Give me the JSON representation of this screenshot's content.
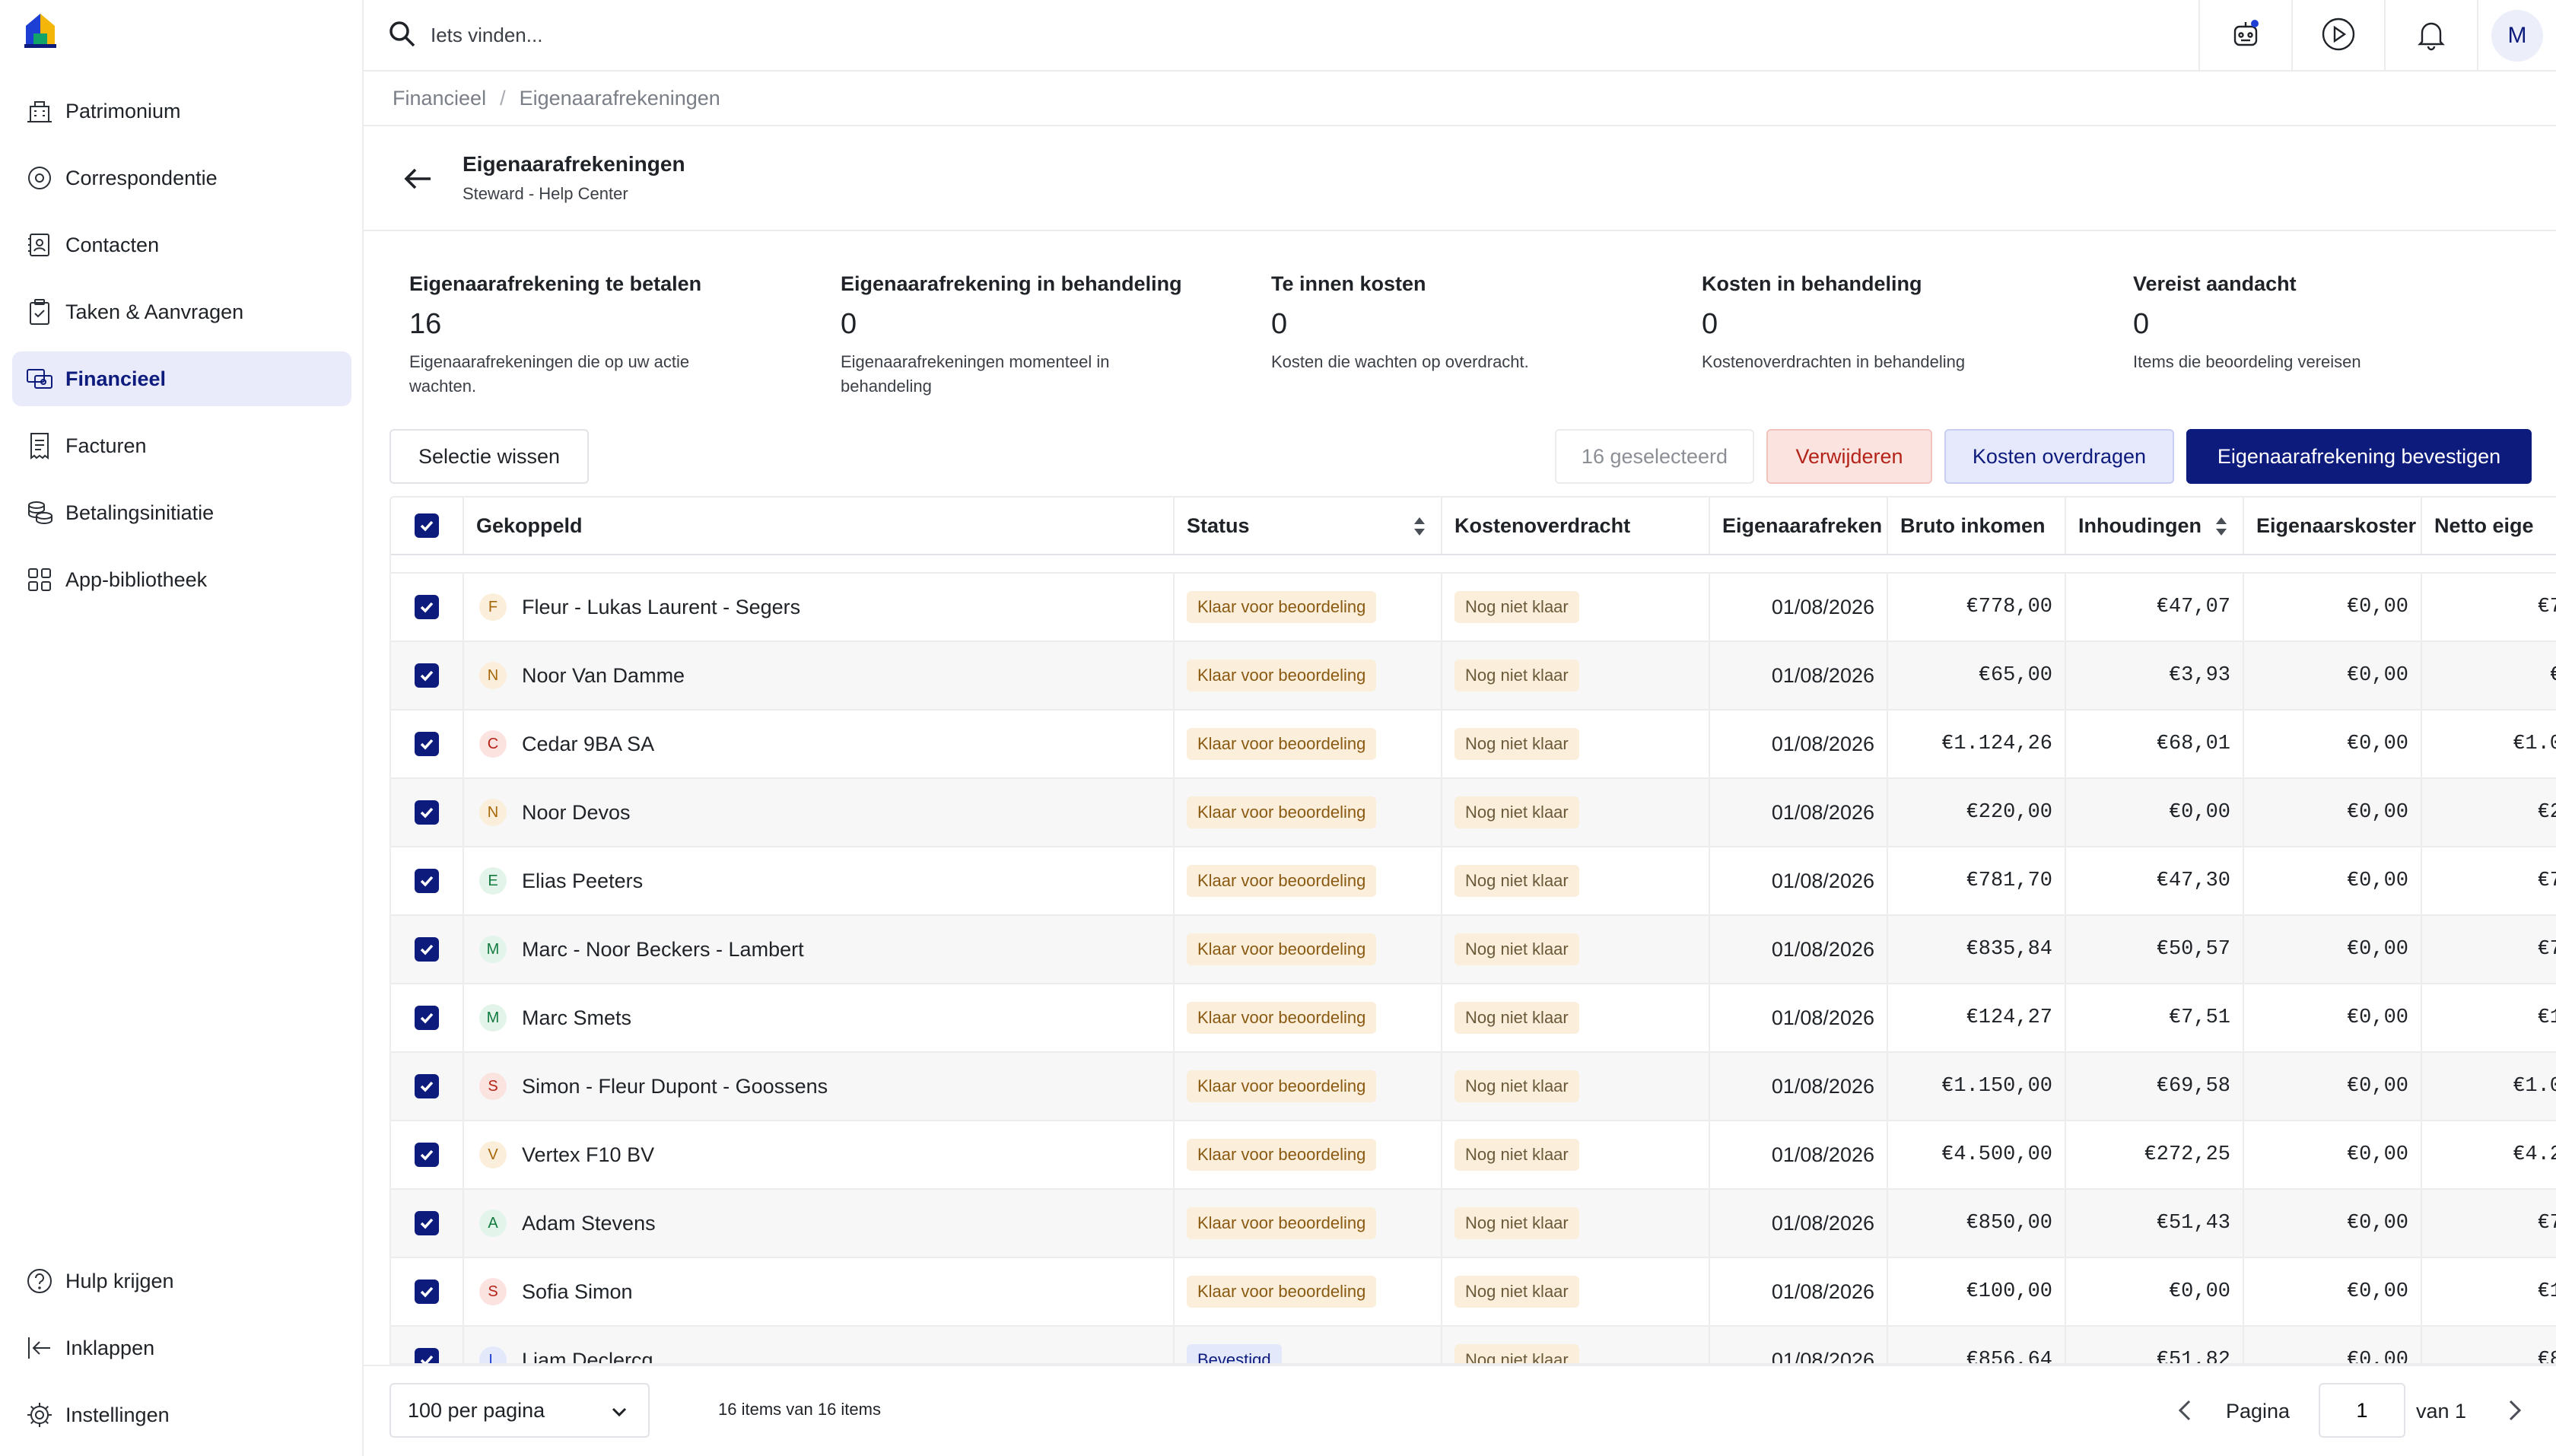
{
  "search": {
    "placeholder": "Iets vinden..."
  },
  "avatar_initial": "M",
  "sidebar": {
    "items": [
      {
        "label": "Patrimonium",
        "icon": "building-icon"
      },
      {
        "label": "Correspondentie",
        "icon": "at-sign-icon"
      },
      {
        "label": "Contacten",
        "icon": "contacts-book-icon"
      },
      {
        "label": "Taken & Aanvragen",
        "icon": "clipboard-check-icon"
      },
      {
        "label": "Financieel",
        "icon": "coins-icon",
        "active": true
      },
      {
        "label": "Facturen",
        "icon": "receipt-icon"
      },
      {
        "label": "Betalingsinitiatie",
        "icon": "coin-stack-icon"
      },
      {
        "label": "App-bibliotheek",
        "icon": "grid-icon"
      }
    ],
    "bottom": [
      {
        "label": "Hulp krijgen",
        "icon": "help-circle-icon"
      },
      {
        "label": "Inklappen",
        "icon": "collapse-icon"
      },
      {
        "label": "Instellingen",
        "icon": "gear-icon"
      }
    ]
  },
  "breadcrumb": {
    "parent": "Financieel",
    "sep": "/",
    "current": "Eigenaarafrekeningen"
  },
  "header": {
    "title": "Eigenaarafrekeningen",
    "subtitle": "Steward - Help Center"
  },
  "stats": [
    {
      "title": "Eigenaarafrekening te betalen",
      "value": "16",
      "desc": "Eigenaarafrekeningen die op uw actie wachten."
    },
    {
      "title": "Eigenaarafrekening in behandeling",
      "value": "0",
      "desc": "Eigenaarafrekeningen momenteel in behandeling"
    },
    {
      "title": "Te innen kosten",
      "value": "0",
      "desc": "Kosten die wachten op overdracht."
    },
    {
      "title": "Kosten in behandeling",
      "value": "0",
      "desc": "Kostenoverdrachten in behandeling"
    },
    {
      "title": "Vereist aandacht",
      "value": "0",
      "desc": "Items die beoordeling vereisen"
    }
  ],
  "actions": {
    "clear": "Selectie wissen",
    "selected": "16 geselecteerd",
    "delete": "Verwijderen",
    "transfer": "Kosten overdragen",
    "confirm": "Eigenaarafrekening bevestigen"
  },
  "table": {
    "columns": [
      "Gekoppeld",
      "Status",
      "Kostenoverdracht",
      "Eigenaarafreken",
      "Bruto inkomen",
      "Inhoudingen",
      "Eigenaarskoster",
      "Netto eige"
    ],
    "rows": [
      {
        "initial": "F",
        "tone": "amber",
        "name": "Fleur - Lukas Laurent - Segers",
        "status": "Klaar voor beoordeling",
        "transfer": "Nog niet klaar",
        "date": "01/08/2026",
        "gross": "€778,00",
        "deductions": "€47,07",
        "costs": "€0,00",
        "net": "€7"
      },
      {
        "initial": "N",
        "tone": "amber",
        "name": "Noor Van Damme",
        "status": "Klaar voor beoordeling",
        "transfer": "Nog niet klaar",
        "date": "01/08/2026",
        "gross": "€65,00",
        "deductions": "€3,93",
        "costs": "€0,00",
        "net": "€"
      },
      {
        "initial": "C",
        "tone": "red",
        "name": "Cedar 9BA SA",
        "status": "Klaar voor beoordeling",
        "transfer": "Nog niet klaar",
        "date": "01/08/2026",
        "gross": "€1.124,26",
        "deductions": "€68,01",
        "costs": "€0,00",
        "net": "€1.0"
      },
      {
        "initial": "N",
        "tone": "amber",
        "name": "Noor Devos",
        "status": "Klaar voor beoordeling",
        "transfer": "Nog niet klaar",
        "date": "01/08/2026",
        "gross": "€220,00",
        "deductions": "€0,00",
        "costs": "€0,00",
        "net": "€2"
      },
      {
        "initial": "E",
        "tone": "green",
        "name": "Elias Peeters",
        "status": "Klaar voor beoordeling",
        "transfer": "Nog niet klaar",
        "date": "01/08/2026",
        "gross": "€781,70",
        "deductions": "€47,30",
        "costs": "€0,00",
        "net": "€7"
      },
      {
        "initial": "M",
        "tone": "green",
        "name": "Marc - Noor Beckers - Lambert",
        "status": "Klaar voor beoordeling",
        "transfer": "Nog niet klaar",
        "date": "01/08/2026",
        "gross": "€835,84",
        "deductions": "€50,57",
        "costs": "€0,00",
        "net": "€7"
      },
      {
        "initial": "M",
        "tone": "green",
        "name": "Marc Smets",
        "status": "Klaar voor beoordeling",
        "transfer": "Nog niet klaar",
        "date": "01/08/2026",
        "gross": "€124,27",
        "deductions": "€7,51",
        "costs": "€0,00",
        "net": "€1"
      },
      {
        "initial": "S",
        "tone": "red",
        "name": "Simon - Fleur Dupont - Goossens",
        "status": "Klaar voor beoordeling",
        "transfer": "Nog niet klaar",
        "date": "01/08/2026",
        "gross": "€1.150,00",
        "deductions": "€69,58",
        "costs": "€0,00",
        "net": "€1.0"
      },
      {
        "initial": "V",
        "tone": "amber",
        "name": "Vertex F10 BV",
        "status": "Klaar voor beoordeling",
        "transfer": "Nog niet klaar",
        "date": "01/08/2026",
        "gross": "€4.500,00",
        "deductions": "€272,25",
        "costs": "€0,00",
        "net": "€4.2"
      },
      {
        "initial": "A",
        "tone": "green",
        "name": "Adam Stevens",
        "status": "Klaar voor beoordeling",
        "transfer": "Nog niet klaar",
        "date": "01/08/2026",
        "gross": "€850,00",
        "deductions": "€51,43",
        "costs": "€0,00",
        "net": "€7"
      },
      {
        "initial": "S",
        "tone": "red",
        "name": "Sofia Simon",
        "status": "Klaar voor beoordeling",
        "transfer": "Nog niet klaar",
        "date": "01/08/2026",
        "gross": "€100,00",
        "deductions": "€0,00",
        "costs": "€0,00",
        "net": "€1"
      },
      {
        "initial": "L",
        "tone": "blue",
        "name": "Liam Declercq",
        "status": "Bevestigd",
        "transfer": "Nog niet klaar",
        "date": "01/08/2026",
        "gross": "€856,64",
        "deductions": "€51,82",
        "costs": "€0,00",
        "net": "€8"
      }
    ]
  },
  "footer": {
    "per_page": "100 per pagina",
    "items_info": "16 items van 16 items",
    "page_label": "Pagina",
    "page": "1",
    "of": "van 1"
  },
  "colors": {
    "primary": "#0d1b7d",
    "accent_bg": "#e9ebfb",
    "danger_bg": "#fbe3e0",
    "danger_text": "#b42318",
    "badge_bg": "#fbeedb"
  }
}
